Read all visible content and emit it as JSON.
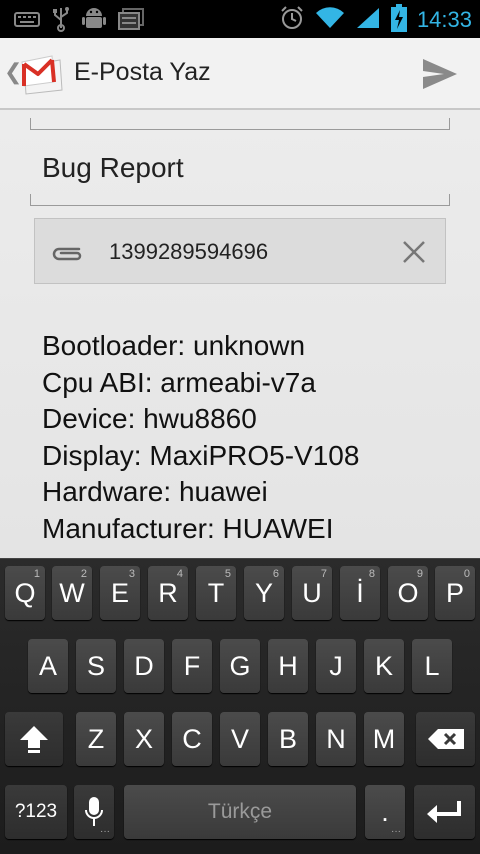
{
  "status_bar": {
    "time": "14:33",
    "icons_left": [
      "keyboard-icon",
      "usb-icon",
      "android-debug-icon",
      "notification-stack-icon"
    ],
    "icons_right": [
      "alarm-icon",
      "wifi-icon",
      "signal-icon",
      "battery-charging-icon"
    ]
  },
  "action_bar": {
    "title": "E-Posta Yaz",
    "logo": "gmail-icon",
    "send": "send-icon"
  },
  "compose": {
    "subject": "Bug Report",
    "attachment": {
      "name": "1399289594696",
      "icon": "paperclip-icon",
      "remove_icon": "close-icon"
    },
    "body_lines": [
      "Bootloader: unknown",
      "Cpu ABI: armeabi-v7a",
      "Device: hwu8860",
      "Display: MaxiPRO5-V108",
      "Hardware: huawei",
      "Manufacturer: HUAWEI"
    ]
  },
  "keyboard": {
    "row1": [
      {
        "label": "Q",
        "hint": "1"
      },
      {
        "label": "W",
        "hint": "2"
      },
      {
        "label": "E",
        "hint": "3"
      },
      {
        "label": "R",
        "hint": "4"
      },
      {
        "label": "T",
        "hint": "5"
      },
      {
        "label": "Y",
        "hint": "6"
      },
      {
        "label": "U",
        "hint": "7"
      },
      {
        "label": "İ",
        "hint": "8"
      },
      {
        "label": "O",
        "hint": "9"
      },
      {
        "label": "P",
        "hint": "0"
      }
    ],
    "row2": [
      "A",
      "S",
      "D",
      "F",
      "G",
      "H",
      "J",
      "K",
      "L"
    ],
    "row3": [
      "Z",
      "X",
      "C",
      "V",
      "B",
      "N",
      "M"
    ],
    "symbols_label": "?123",
    "space_label": "Türkçe",
    "period_label": ".",
    "shift_icon": "shift-icon",
    "backspace_icon": "backspace-icon",
    "mic_icon": "mic-icon",
    "enter_icon": "enter-icon"
  }
}
